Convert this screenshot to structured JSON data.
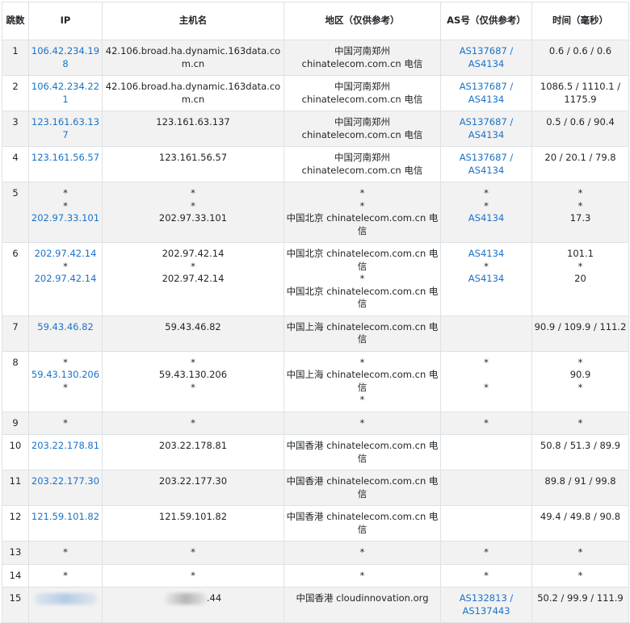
{
  "headers": {
    "hop": "跳数",
    "ip": "IP",
    "host": "主机名",
    "region": "地区（仅供参考）",
    "as": "AS号（仅供参考）",
    "time": "时间（毫秒）"
  },
  "rows": [
    {
      "hop": "1",
      "ip": [
        "106.42.234.198"
      ],
      "host": [
        "42.106.broad.ha.dynamic.163data.com.cn"
      ],
      "region": [
        "中国河南郑州 chinatelecom.com.cn 电信"
      ],
      "as": [
        "AS137687 / AS4134"
      ],
      "time": [
        "0.6 / 0.6 / 0.6"
      ]
    },
    {
      "hop": "2",
      "ip": [
        "106.42.234.221"
      ],
      "host": [
        "42.106.broad.ha.dynamic.163data.com.cn"
      ],
      "region": [
        "中国河南郑州 chinatelecom.com.cn 电信"
      ],
      "as": [
        "AS137687 / AS4134"
      ],
      "time": [
        "1086.5 / 1110.1 / 1175.9"
      ]
    },
    {
      "hop": "3",
      "ip": [
        "123.161.63.137"
      ],
      "host": [
        "123.161.63.137"
      ],
      "region": [
        "中国河南郑州 chinatelecom.com.cn 电信"
      ],
      "as": [
        "AS137687 / AS4134"
      ],
      "time": [
        "0.5 / 0.6 / 90.4"
      ]
    },
    {
      "hop": "4",
      "ip": [
        "123.161.56.57"
      ],
      "host": [
        "123.161.56.57"
      ],
      "region": [
        "中国河南郑州 chinatelecom.com.cn 电信"
      ],
      "as": [
        "AS137687 / AS4134"
      ],
      "time": [
        "20 / 20.1 / 79.8"
      ]
    },
    {
      "hop": "5",
      "ip": [
        "*",
        "*",
        "202.97.33.101"
      ],
      "host": [
        "*",
        "*",
        "202.97.33.101"
      ],
      "region": [
        "*",
        "*",
        "中国北京 chinatelecom.com.cn 电信"
      ],
      "as": [
        "*",
        "*",
        "AS4134"
      ],
      "time": [
        "*",
        "*",
        "17.3"
      ]
    },
    {
      "hop": "6",
      "ip": [
        "202.97.42.14",
        "*",
        "202.97.42.14"
      ],
      "host": [
        "202.97.42.14",
        "*",
        "202.97.42.14"
      ],
      "region": [
        "中国北京 chinatelecom.com.cn 电信",
        "*",
        "中国北京 chinatelecom.com.cn 电信"
      ],
      "as": [
        "AS4134",
        "*",
        "AS4134"
      ],
      "time": [
        "101.1",
        "*",
        "20"
      ]
    },
    {
      "hop": "7",
      "ip": [
        "59.43.46.82"
      ],
      "host": [
        "59.43.46.82"
      ],
      "region": [
        "中国上海 chinatelecom.com.cn 电信"
      ],
      "as": [
        ""
      ],
      "time": [
        "90.9 / 109.9 / 111.2"
      ]
    },
    {
      "hop": "8",
      "ip": [
        "*",
        "59.43.130.206",
        "*"
      ],
      "host": [
        "*",
        "59.43.130.206",
        "*"
      ],
      "region": [
        "*",
        "中国上海 chinatelecom.com.cn 电信",
        "*"
      ],
      "as": [
        "*",
        "",
        "*"
      ],
      "time": [
        "*",
        "90.9",
        "*"
      ]
    },
    {
      "hop": "9",
      "ip": [
        "*"
      ],
      "host": [
        "*"
      ],
      "region": [
        "*"
      ],
      "as": [
        "*"
      ],
      "time": [
        "*"
      ]
    },
    {
      "hop": "10",
      "ip": [
        "203.22.178.81"
      ],
      "host": [
        "203.22.178.81"
      ],
      "region": [
        "中国香港 chinatelecom.com.cn 电信"
      ],
      "as": [
        ""
      ],
      "time": [
        "50.8 / 51.3 / 89.9"
      ]
    },
    {
      "hop": "11",
      "ip": [
        "203.22.177.30"
      ],
      "host": [
        "203.22.177.30"
      ],
      "region": [
        "中国香港 chinatelecom.com.cn 电信"
      ],
      "as": [
        ""
      ],
      "time": [
        "89.8 / 91 / 99.8"
      ]
    },
    {
      "hop": "12",
      "ip": [
        "121.59.101.82"
      ],
      "host": [
        "121.59.101.82"
      ],
      "region": [
        "中国香港 chinatelecom.com.cn 电信"
      ],
      "as": [
        ""
      ],
      "time": [
        "49.4 / 49.8 / 90.8"
      ]
    },
    {
      "hop": "13",
      "ip": [
        "*"
      ],
      "host": [
        "*"
      ],
      "region": [
        "*"
      ],
      "as": [
        "*"
      ],
      "time": [
        "*"
      ]
    },
    {
      "hop": "14",
      "ip": [
        "*"
      ],
      "host": [
        "*"
      ],
      "region": [
        "*"
      ],
      "as": [
        "*"
      ],
      "time": [
        "*"
      ]
    },
    {
      "hop": "15",
      "ip": [
        ""
      ],
      "host": [
        ".44"
      ],
      "region": [
        "中国香港 cloudinnovation.org"
      ],
      "as": [
        "AS132813 / AS137443"
      ],
      "time": [
        "50.2 / 99.9 / 111.9"
      ]
    }
  ],
  "colors": {
    "link": "#1a73c8",
    "stripe": "#f2f2f2",
    "border": "#dee2e6"
  }
}
